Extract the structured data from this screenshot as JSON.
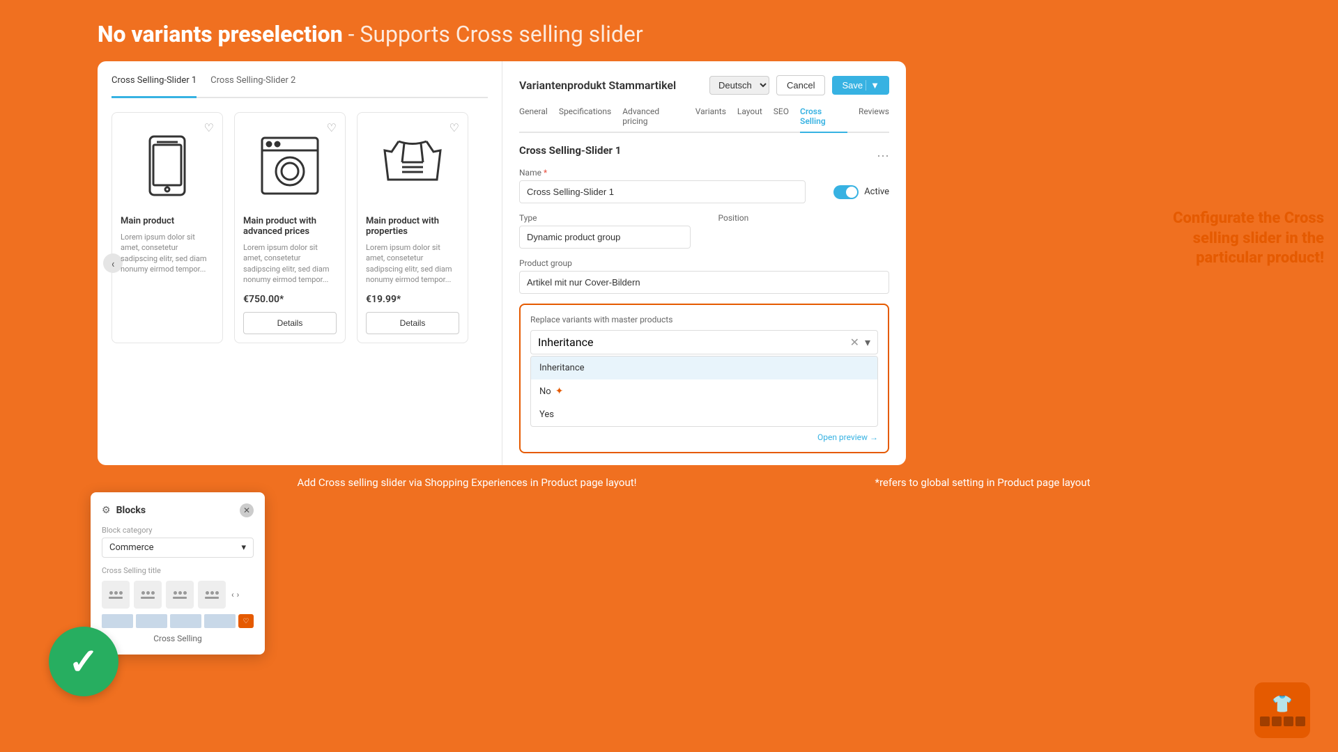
{
  "header": {
    "title_bold": "No variants preselection",
    "title_rest": " - Supports Cross selling slider"
  },
  "left_panel": {
    "tabs": [
      {
        "label": "Cross Selling-Slider 1",
        "active": true
      },
      {
        "label": "Cross Selling-Slider 2",
        "active": false
      }
    ],
    "products": [
      {
        "name": "Main product",
        "desc": "Lorem ipsum dolor sit amet, consetetur sadipscing elitr, sed diam nonumy eirmod tempor...",
        "price": "",
        "has_details": false,
        "icon": "phone"
      },
      {
        "name": "Main product with advanced prices",
        "desc": "Lorem ipsum dolor sit amet, consetetur sadipscing elitr, sed diam nonumy eirmod tempor...",
        "price": "€750.00*",
        "has_details": true,
        "icon": "washer"
      },
      {
        "name": "Main product with properties",
        "desc": "Lorem ipsum dolor sit amet, consetetur sadipscing elitr, sed diam nonumy eirmod tempor...",
        "price": "€19.99*",
        "has_details": true,
        "icon": "jacket"
      }
    ]
  },
  "blocks_panel": {
    "title": "Blocks",
    "category_label": "Block category",
    "category_value": "Commerce",
    "section_label": "Cross Selling title",
    "item_label": "Cross Selling"
  },
  "right_panel": {
    "admin_title": "Variantenprodukt Stammartikel",
    "lang": "Deutsch",
    "btn_cancel": "Cancel",
    "btn_save": "Save",
    "tabs": [
      "General",
      "Specifications",
      "Advanced pricing",
      "Variants",
      "Layout",
      "SEO",
      "Cross Selling",
      "Reviews"
    ],
    "active_tab": "Cross Selling",
    "section_title": "Cross Selling-Slider 1",
    "name_label": "Name",
    "name_required": "*",
    "name_value": "Cross Selling-Slider 1",
    "active_label": "Active",
    "type_label": "Type",
    "type_value": "Dynamic product group",
    "position_label": "Position",
    "product_group_label": "Product group",
    "product_group_value": "Artikel mit nur Cover-Bildern",
    "replace_label": "Replace variants with master products",
    "dropdown_value": "Inheritance",
    "options": [
      "Inheritance",
      "No",
      "Yes"
    ],
    "open_preview": "Open preview →"
  },
  "callout": {
    "text": "Configurate the Cross selling slider in the particular product!"
  },
  "bottom": {
    "left_text": "Add Cross selling slider via Shopping Experiences in Product page layout!",
    "right_text": "*refers to global setting in Product page layout"
  }
}
